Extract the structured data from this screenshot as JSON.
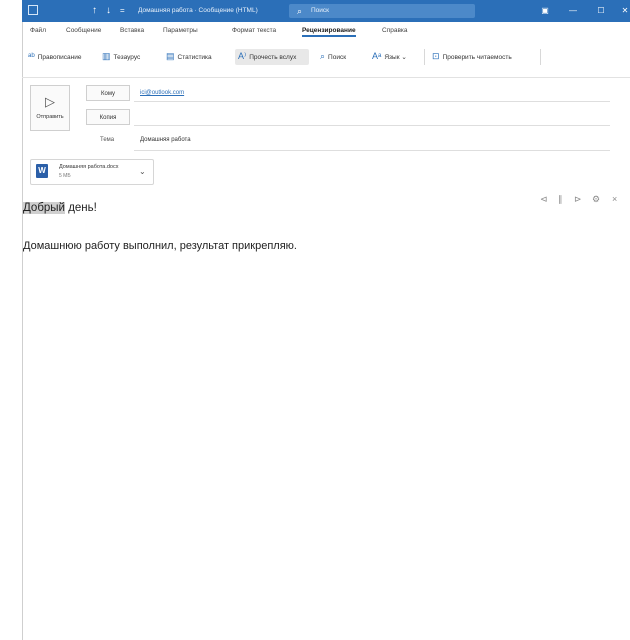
{
  "titlebar": {
    "title": "Домашняя работа · Сообщение (HTML)",
    "search_placeholder": "Поиск"
  },
  "menu": {
    "tabs": [
      "Файл",
      "Сообщение",
      "Вставка",
      "Параметры",
      "Формат текста",
      "Рецензирование",
      "Справка"
    ]
  },
  "ribbon": {
    "spelling": "Правописание",
    "thesaurus": "Тезаурус",
    "stats": "Статистика",
    "read_aloud": "Прочесть вслух",
    "search": "Поиск",
    "language": "Язык",
    "accessibility": "Проверить читаемость"
  },
  "compose": {
    "send_label": "Отправить",
    "to_label": "Кому",
    "to_value": "ici@outlook.com",
    "cc_label": "Копия",
    "subject_label": "Тема",
    "subject_value": "Домашняя работа"
  },
  "attachment": {
    "name": "Домашняя работа.docx",
    "size": "5 МБ"
  },
  "body": {
    "greeting_highlight": "Добрый",
    "greeting_rest": " день!",
    "line1": "Домашнюю работу выполнил, результат прикрепляю."
  }
}
